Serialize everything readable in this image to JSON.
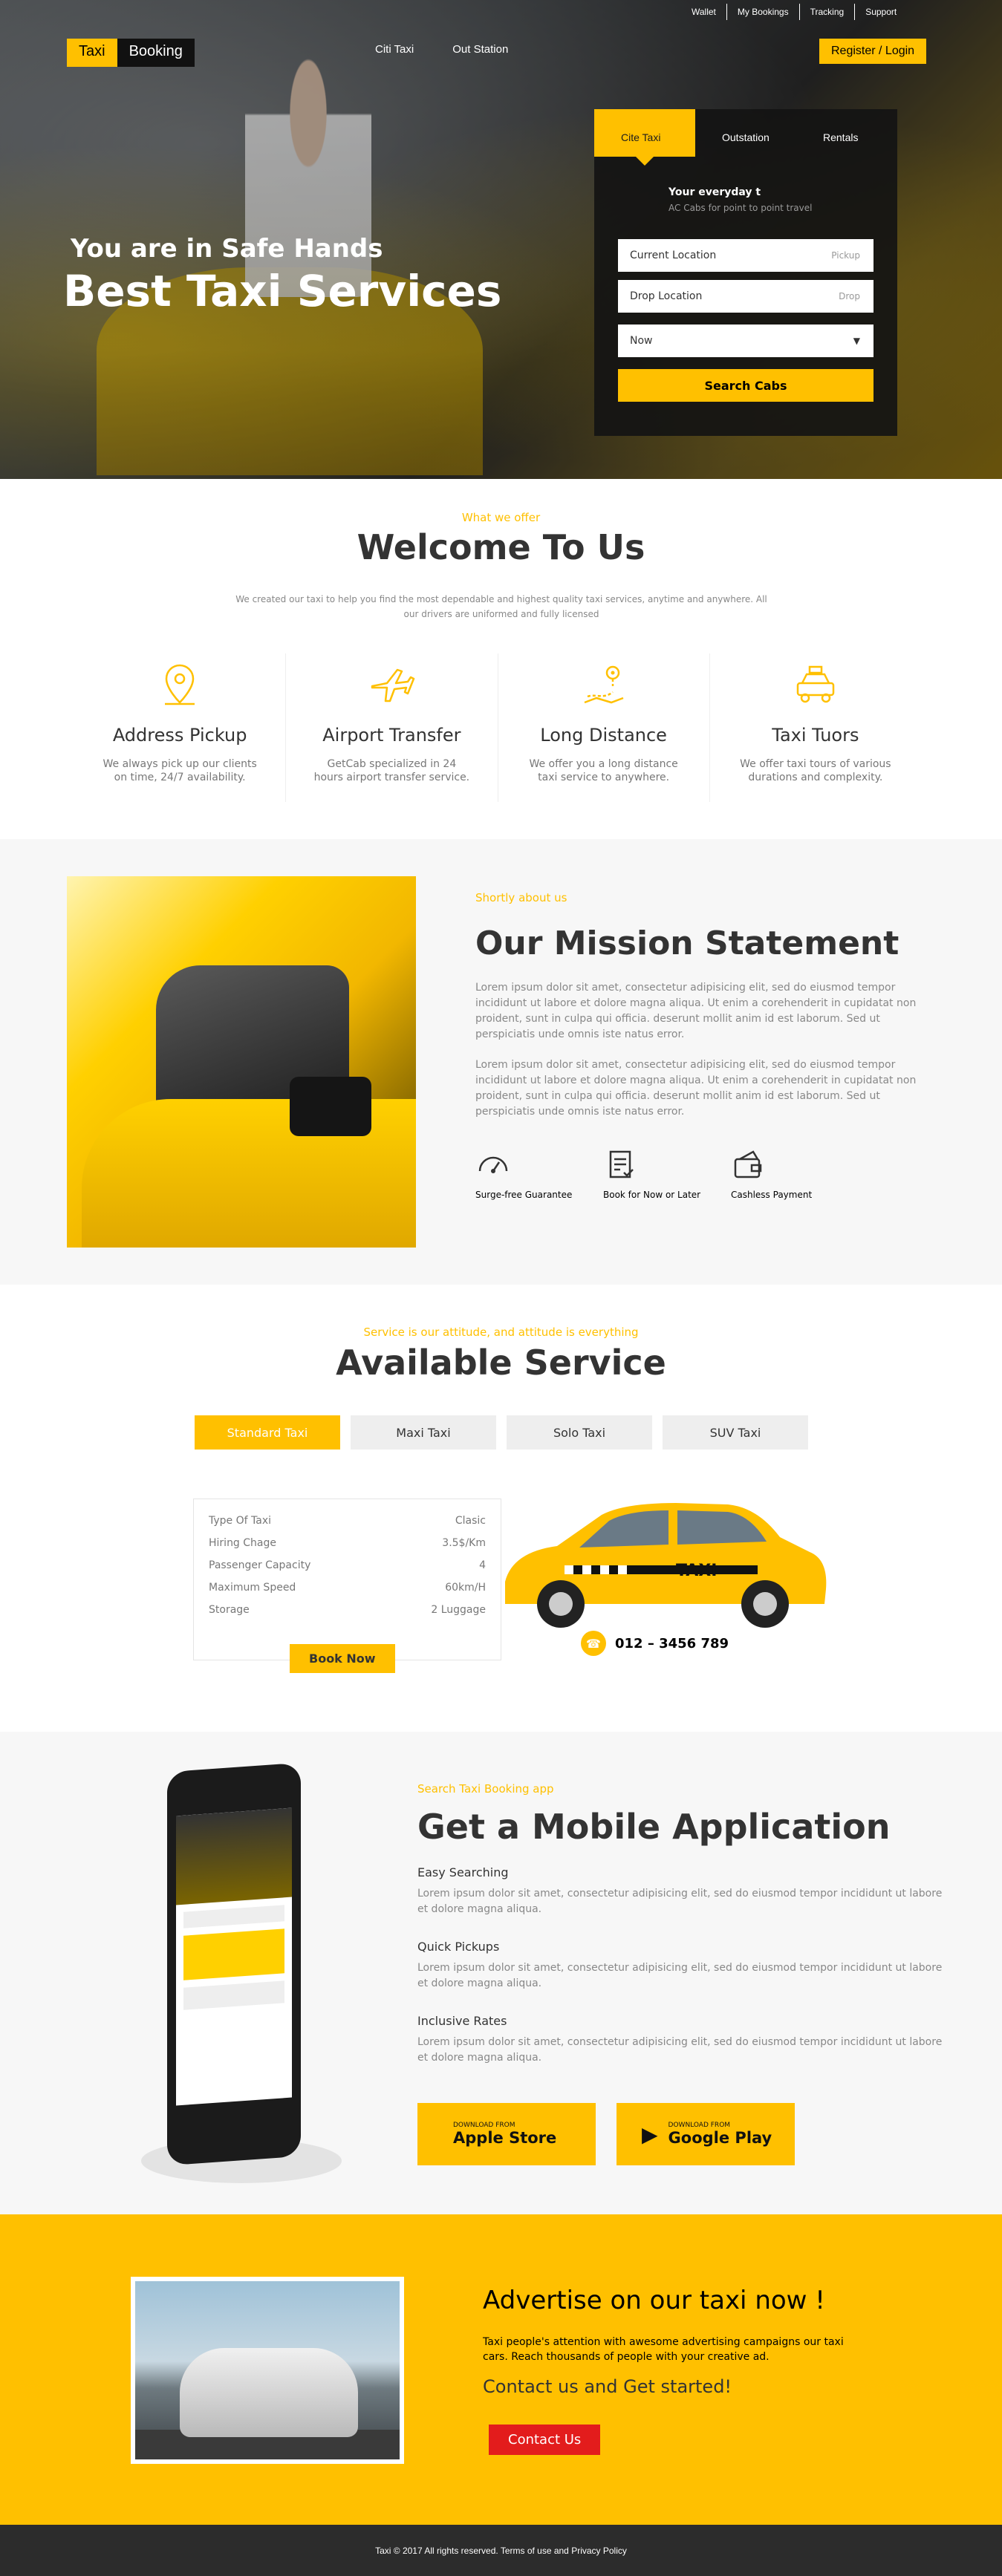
{
  "topnav": [
    "Wallet",
    "My Bookings",
    "Tracking",
    "Support"
  ],
  "logo": {
    "part1": "Taxi",
    "part2": "Booking"
  },
  "mainnav": [
    "Citi Taxi",
    "Out Station"
  ],
  "register_login": "Register / Login",
  "hero": {
    "tagline": "You are in Safe Hands",
    "headline": "Best Taxi Services"
  },
  "booking": {
    "tabs": [
      "Cite Taxi",
      "Outstation",
      "Rentals"
    ],
    "title": "Your everyday t",
    "subtitle": "AC Cabs for point to point travel",
    "current_location": "Current Location",
    "pickup_hint": "Pickup",
    "drop_location": "Drop  Location",
    "drop_hint": "Drop",
    "when": "Now",
    "search": "Search Cabs"
  },
  "welcome": {
    "kicker": "What we offer",
    "title": "Welcome To Us",
    "desc": "We created our taxi to help you find the most dependable and highest quality taxi services, anytime and anywhere. All our drivers are uniformed and fully licensed",
    "features": [
      {
        "title": "Address Pickup",
        "desc": "We always pick up our clients on time, 24/7 availability."
      },
      {
        "title": "Airport Transfer",
        "desc": "GetCab specialized in 24 hours airport transfer service."
      },
      {
        "title": "Long Distance",
        "desc": "We offer you a long distance taxi service to anywhere."
      },
      {
        "title": "Taxi Tuors",
        "desc": "We offer taxi tours of various durations and complexity."
      }
    ]
  },
  "mission": {
    "kicker": "Shortly about us",
    "title": "Our Mission Statement",
    "p1": "Lorem ipsum dolor sit amet, consectetur adipisicing elit, sed do eiusmod tempor incididunt ut labore et dolore magna aliqua. Ut enim a corehenderit in cupidatat non proident, sunt in culpa qui officia. deserunt mollit anim id est laborum. Sed ut perspiciatis unde omnis iste natus error.",
    "p2": "Lorem ipsum dolor sit amet, consectetur adipisicing elit, sed do eiusmod tempor incididunt ut labore et dolore magna aliqua. Ut enim a corehenderit in cupidatat non proident, sunt in culpa qui officia. deserunt mollit anim id est laborum. Sed ut perspiciatis unde omnis iste natus error.",
    "icons": [
      {
        "label": "Surge-free Guarantee"
      },
      {
        "label": "Book for Now or Later"
      },
      {
        "label": "Cashless Payment"
      }
    ]
  },
  "service": {
    "kicker": "Service is our attitude, and attitude is everything",
    "title": "Available Service",
    "tabs": [
      "Standard Taxi",
      "Maxi Taxi",
      "Solo Taxi",
      "SUV Taxi"
    ],
    "specs": [
      {
        "k": "Type Of Taxi",
        "v": "Clasic"
      },
      {
        "k": "Hiring Chage",
        "v": "3.5$/Km"
      },
      {
        "k": "Passenger Capacity",
        "v": "4"
      },
      {
        "k": "Maximum Speed",
        "v": "60km/H"
      },
      {
        "k": "Storage",
        "v": "2 Luggage"
      }
    ],
    "book": "Book Now",
    "phone": "012 – 3456 789",
    "car_label": "TAXI"
  },
  "app": {
    "kicker": "Search Taxi Booking app",
    "title": "Get a Mobile Application",
    "items": [
      {
        "title": "Easy Searching",
        "desc": "Lorem ipsum dolor sit amet, consectetur adipisicing elit, sed do eiusmod tempor incididunt ut labore et dolore magna aliqua."
      },
      {
        "title": "Quick Pickups",
        "desc": "Lorem ipsum dolor sit amet, consectetur adipisicing elit, sed do eiusmod tempor incididunt ut labore et dolore magna aliqua."
      },
      {
        "title": "Inclusive Rates",
        "desc": "Lorem ipsum dolor sit amet, consectetur adipisicing elit, sed do eiusmod tempor incididunt ut labore et dolore magna aliqua."
      }
    ],
    "apple": {
      "small": "DOWNLOAD FROM",
      "big": "Apple Store"
    },
    "google": {
      "small": "DOWNLOAD FROM",
      "big": "Google Play"
    }
  },
  "advertise": {
    "title": "Advertise on our taxi now !",
    "desc": "Taxi people's attention with awesome advertising campaigns our taxi cars. Reach thousands of people with your creative ad.",
    "sub": "Contact us and Get started!",
    "button": "Contact Us"
  },
  "footer": {
    "text": "Taxi © 2017 All rights reserved. Terms of use and Privacy Policy"
  },
  "colors": {
    "accent": "#ffc000",
    "dark": "#333333",
    "muted": "#888888",
    "cta": "#e31c1c"
  }
}
